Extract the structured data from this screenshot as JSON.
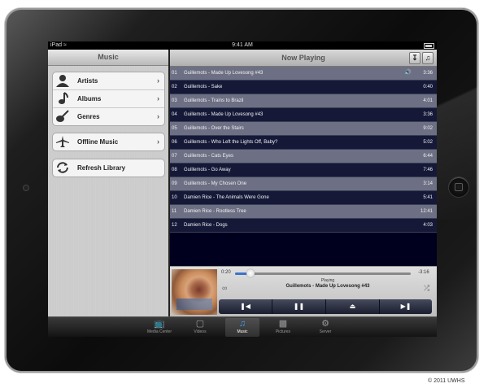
{
  "status_bar": {
    "device": "iPad",
    "wifi_icon": "wifi-icon",
    "time": "9:41 AM",
    "battery_icon": "battery-icon"
  },
  "sidebar": {
    "title": "Music",
    "library_items": [
      {
        "label": "Artists",
        "icon": "person-icon"
      },
      {
        "label": "Albums",
        "icon": "music-note-icon"
      },
      {
        "label": "Genres",
        "icon": "guitar-icon"
      }
    ],
    "offline_item": {
      "label": "Offline Music",
      "icon": "airplane-icon"
    },
    "refresh_item": {
      "label": "Refresh Library",
      "icon": "refresh-icon"
    }
  },
  "now_playing": {
    "title": "Now Playing",
    "tracks": [
      {
        "no": "01",
        "name": "Guillemots - Made Up Lovesong #43",
        "duration": "3:36",
        "playing": true
      },
      {
        "no": "02",
        "name": "Guillemots - Sake",
        "duration": "0:40",
        "playing": false
      },
      {
        "no": "03",
        "name": "Guillemots - Trains to Brazil",
        "duration": "4:01",
        "playing": false
      },
      {
        "no": "04",
        "name": "Guillemots - Made Up Lovesong #43",
        "duration": "3:36",
        "playing": false
      },
      {
        "no": "05",
        "name": "Guillemots - Over the Stairs",
        "duration": "9:02",
        "playing": false
      },
      {
        "no": "06",
        "name": "Guillemots - Who Left the Lights Off, Baby?",
        "duration": "5:02",
        "playing": false
      },
      {
        "no": "07",
        "name": "Guillemots - Cats Eyes",
        "duration": "6:44",
        "playing": false
      },
      {
        "no": "08",
        "name": "Guillemots - Go Away",
        "duration": "7:46",
        "playing": false
      },
      {
        "no": "09",
        "name": "Guillemots - My Chosen One",
        "duration": "3:14",
        "playing": false
      },
      {
        "no": "10",
        "name": "Damien Rice - The Animals Were Gone",
        "duration": "5:41",
        "playing": false
      },
      {
        "no": "11",
        "name": "Damien Rice - Rootless Tree",
        "duration": "12:41",
        "playing": false
      },
      {
        "no": "12",
        "name": "Damien Rice - Dogs",
        "duration": "4:03",
        "playing": false
      }
    ]
  },
  "player": {
    "elapsed": "0:20",
    "remaining": "-3:16",
    "progress": 0.09,
    "state": "Playing",
    "track": "Guillemots - Made Up Lovesong #43",
    "controls": {
      "previous": "previous-icon",
      "pause": "pause-icon",
      "eject": "eject-icon",
      "next": "next-icon"
    }
  },
  "tabs": [
    {
      "label": "Media Center",
      "icon": "tv-icon",
      "active": false
    },
    {
      "label": "Videos",
      "icon": "monitor-icon",
      "active": false
    },
    {
      "label": "Music",
      "icon": "music-note-icon",
      "active": true
    },
    {
      "label": "Pictures",
      "icon": "picture-icon",
      "active": false
    },
    {
      "label": "Server",
      "icon": "gear-icon",
      "active": false
    }
  ],
  "copyright": "© 2011 UWHS",
  "colors": {
    "accent_blue": "#3b73c8",
    "list_bg": "#00001e",
    "tab_active": "#39a0ff"
  }
}
